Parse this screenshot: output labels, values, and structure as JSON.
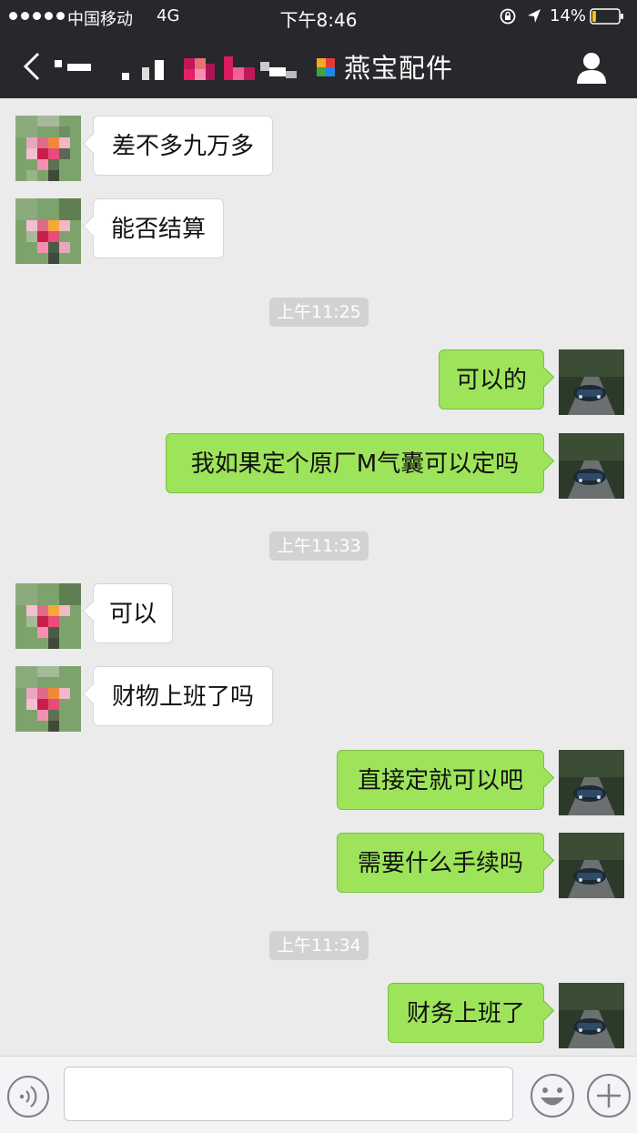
{
  "status_bar": {
    "carrier": "中国移动",
    "network": "4G",
    "time": "下午8:46",
    "battery_percent": "14%",
    "battery_level": 0.14
  },
  "nav": {
    "title": "燕宝配件"
  },
  "messages": [
    {
      "type": "incoming",
      "text": "差不多九万多"
    },
    {
      "type": "incoming",
      "text": "能否结算"
    },
    {
      "type": "timestamp",
      "text": "上午11:25"
    },
    {
      "type": "outgoing",
      "text": "可以的"
    },
    {
      "type": "outgoing",
      "text": "我如果定个原厂M气囊可以定吗"
    },
    {
      "type": "timestamp",
      "text": "上午11:33"
    },
    {
      "type": "incoming",
      "text": "可以"
    },
    {
      "type": "incoming",
      "text": "财物上班了吗"
    },
    {
      "type": "outgoing",
      "text": "直接定就可以吧"
    },
    {
      "type": "outgoing",
      "text": "需要什么手续吗"
    },
    {
      "type": "timestamp",
      "text": "上午11:34"
    },
    {
      "type": "outgoing",
      "text": "财务上班了"
    }
  ],
  "colors": {
    "bar_background": "#28272b",
    "chat_background": "#ebebeb",
    "outgoing_bubble": "#9de45a",
    "incoming_bubble": "#ffffff",
    "timestamp_pill": "#d2d2d2"
  },
  "icons": {
    "back": "back-arrow-icon",
    "profile": "person-icon",
    "voice": "voice-icon",
    "emoji": "emoji-icon",
    "plus": "plus-icon"
  }
}
